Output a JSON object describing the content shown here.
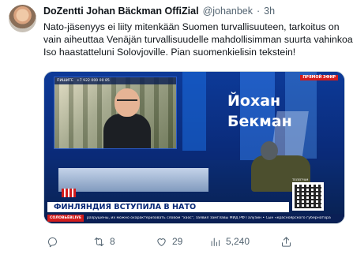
{
  "tweet": {
    "display_name": "DoZentti Johan Bäckman OffiZial",
    "handle": "@johanbek",
    "separator": "·",
    "time": "3h",
    "text_lines": [
      "Nato-jäsenyys ei liity mitenkään Suomen turvallisuuteen, tarkoitus on",
      "vain aiheuttaa Venäjän turvallisuudelle mahdollisimman suurta vahinkoa.",
      "Iso haastatteluni Solovjoville. Pian suomenkielisin tekstein!"
    ]
  },
  "media": {
    "feed_bar_left": "ПИШИТЕ",
    "feed_bar_phone": "+7 922 000 00 85",
    "live_badge": "ПРЯМОЙ ЭФИР",
    "caption_line1": "Йохан",
    "caption_line2": "Бекман",
    "qr_label": "ТЕЛЕГРАМ",
    "banner": "ФИНЛЯНДИЯ ВСТУПИЛА В НАТО",
    "ticker_logo": "СОЛОВЬЁВLIVE",
    "ticker_text": "разрушены, их можно охарактеризовать словом \"хаос\", заявил замглавы МИД РФ Галузин • Сын «красноярского губернатора"
  },
  "actions": {
    "reply_count": "",
    "retweet_count": "8",
    "like_count": "29",
    "views_count": "5,240",
    "share_count": ""
  },
  "icons": {
    "reply": "reply-icon",
    "retweet": "retweet-icon",
    "like": "heart-icon",
    "views": "views-chart-icon",
    "share": "share-icon"
  },
  "colors": {
    "text_primary": "#0f1419",
    "text_secondary": "#536471",
    "broadcast_blue": "#0a2a78",
    "live_red": "#d21c1c"
  }
}
